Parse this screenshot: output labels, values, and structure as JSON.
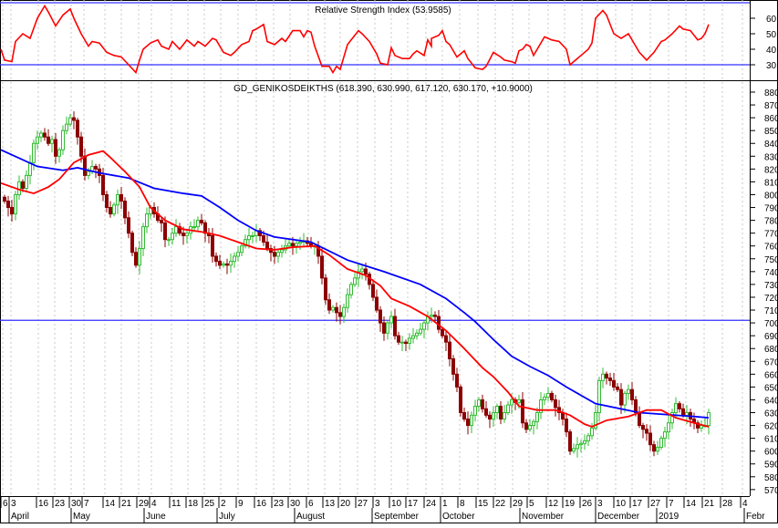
{
  "chart_data": [
    {
      "type": "line",
      "title": "Relative Strength Index (53.9585)",
      "yticks": [
        60,
        50,
        40,
        30
      ],
      "ylim": [
        25,
        72
      ],
      "levels": [
        70,
        30
      ],
      "colors": {
        "line": "#ff0000",
        "levels": "#3333ff"
      },
      "series": [
        {
          "name": "RSI",
          "points": [
            [
              -1,
              40
            ],
            [
              0,
              33
            ],
            [
              2,
              32
            ],
            [
              3,
              45
            ],
            [
              5,
              50
            ],
            [
              7,
              47
            ],
            [
              9,
              60
            ],
            [
              11,
              68
            ],
            [
              12,
              64
            ],
            [
              14,
              55
            ],
            [
              16,
              62
            ],
            [
              18,
              66
            ],
            [
              19,
              60
            ],
            [
              21,
              50
            ],
            [
              23,
              42
            ],
            [
              24,
              45
            ],
            [
              26,
              44
            ],
            [
              28,
              38
            ],
            [
              30,
              36
            ],
            [
              32,
              35
            ],
            [
              34,
              30
            ],
            [
              36,
              25
            ],
            [
              37,
              33
            ],
            [
              38,
              40
            ],
            [
              40,
              44
            ],
            [
              42,
              46
            ],
            [
              43,
              42
            ],
            [
              45,
              40
            ],
            [
              46,
              45
            ],
            [
              48,
              40
            ],
            [
              50,
              46
            ],
            [
              52,
              42
            ],
            [
              53,
              45
            ],
            [
              55,
              42
            ],
            [
              57,
              47
            ],
            [
              58,
              46
            ],
            [
              60,
              38
            ],
            [
              62,
              36
            ],
            [
              63,
              38
            ],
            [
              65,
              43
            ],
            [
              67,
              45
            ],
            [
              68,
              52
            ],
            [
              69,
              53
            ],
            [
              71,
              56
            ],
            [
              72,
              45
            ],
            [
              74,
              43
            ],
            [
              76,
              47
            ],
            [
              77,
              45
            ],
            [
              79,
              52
            ],
            [
              81,
              52
            ],
            [
              82,
              48
            ],
            [
              83,
              52
            ],
            [
              84,
              51
            ],
            [
              85,
              42
            ],
            [
              87,
              29
            ],
            [
              89,
              29
            ],
            [
              90,
              25
            ],
            [
              91,
              29
            ],
            [
              92,
              27
            ],
            [
              94,
              43
            ],
            [
              95,
              46
            ],
            [
              96,
              49
            ],
            [
              97,
              52
            ],
            [
              98,
              50
            ],
            [
              100,
              45
            ],
            [
              102,
              37
            ],
            [
              103,
              31
            ],
            [
              105,
              30
            ],
            [
              106,
              41
            ],
            [
              107,
              36
            ],
            [
              109,
              34
            ],
            [
              111,
              34
            ],
            [
              112,
              37
            ],
            [
              113,
              39
            ],
            [
              115,
              36
            ],
            [
              116,
              46
            ],
            [
              117,
              42
            ],
            [
              117,
              47
            ],
            [
              119,
              49
            ],
            [
              120,
              52
            ],
            [
              121,
              45
            ],
            [
              122,
              43
            ],
            [
              124,
              35
            ],
            [
              126,
              39
            ],
            [
              127,
              34
            ],
            [
              129,
              28
            ],
            [
              131,
              27
            ],
            [
              132,
              29
            ],
            [
              134,
              38
            ],
            [
              136,
              35
            ],
            [
              137,
              33
            ],
            [
              139,
              32
            ],
            [
              140,
              31
            ],
            [
              141,
              39
            ],
            [
              142,
              40
            ],
            [
              143,
              43
            ],
            [
              144,
              42
            ],
            [
              145,
              36
            ],
            [
              146,
              40
            ],
            [
              148,
              48
            ],
            [
              150,
              46
            ],
            [
              152,
              45
            ],
            [
              154,
              40
            ],
            [
              155,
              30
            ],
            [
              156,
              32
            ],
            [
              158,
              36
            ],
            [
              160,
              40
            ],
            [
              161,
              44
            ],
            [
              162,
              60
            ],
            [
              164,
              65
            ],
            [
              165,
              62
            ],
            [
              167,
              50
            ],
            [
              169,
              47
            ],
            [
              171,
              50
            ],
            [
              173,
              42
            ],
            [
              174,
              38
            ],
            [
              176,
              33
            ],
            [
              178,
              38
            ],
            [
              180,
              45
            ],
            [
              181,
              46
            ],
            [
              183,
              50
            ],
            [
              185,
              55
            ],
            [
              186,
              53
            ],
            [
              188,
              52
            ],
            [
              190,
              46
            ],
            [
              191,
              47
            ],
            [
              192,
              50
            ],
            [
              193,
              56
            ]
          ]
        }
      ]
    },
    {
      "type": "candlestick",
      "title": "GD_GENIKOSDEIKTHS (618.390, 630.990, 617.120, 630.170, +10.9000)",
      "ylim": [
        570,
        880
      ],
      "yticks": [
        880,
        870,
        860,
        850,
        840,
        830,
        820,
        810,
        800,
        790,
        780,
        770,
        760,
        750,
        740,
        730,
        720,
        710,
        700,
        690,
        680,
        670,
        660,
        650,
        640,
        630,
        620,
        610,
        600,
        590,
        580,
        570
      ],
      "hline": 702,
      "colors": {
        "up": "#33bb33",
        "down": "#8b0000",
        "ma_fast": "#ff0000",
        "ma_slow": "#0000ff",
        "hline": "#3333ff"
      },
      "closes": [
        795,
        790,
        785,
        800,
        810,
        805,
        815,
        825,
        840,
        845,
        848,
        845,
        840,
        843,
        830,
        835,
        850,
        855,
        860,
        858,
        845,
        830,
        815,
        818,
        822,
        820,
        815,
        800,
        790,
        785,
        792,
        800,
        795,
        782,
        770,
        755,
        745,
        758,
        775,
        785,
        790,
        785,
        780,
        778,
        765,
        765,
        770,
        775,
        770,
        768,
        770,
        775,
        775,
        780,
        778,
        770,
        768,
        752,
        748,
        745,
        746,
        745,
        748,
        752,
        755,
        760,
        765,
        768,
        768,
        772,
        768,
        763,
        758,
        755,
        752,
        755,
        757,
        760,
        762,
        760,
        762,
        763,
        764,
        762,
        760,
        760,
        752,
        735,
        718,
        710,
        712,
        708,
        705,
        712,
        722,
        730,
        735,
        740,
        742,
        738,
        730,
        720,
        710,
        700,
        692,
        700,
        705,
        690,
        685,
        685,
        684,
        688,
        690,
        692,
        695,
        700,
        705,
        706,
        705,
        695,
        690,
        685,
        672,
        660,
        650,
        630,
        625,
        620,
        628,
        635,
        640,
        633,
        628,
        625,
        630,
        635,
        625,
        630,
        636,
        640,
        638,
        640,
        622,
        617,
        620,
        623,
        630,
        640,
        642,
        645,
        640,
        634,
        630,
        625,
        615,
        600,
        602,
        605,
        606,
        608,
        612,
        618,
        630,
        655,
        660,
        657,
        655,
        650,
        648,
        636,
        645,
        648,
        640,
        630,
        620,
        617,
        614,
        605,
        600,
        603,
        610,
        615,
        622,
        630,
        637,
        633,
        628,
        630,
        625,
        622,
        618,
        620,
        620,
        630
      ],
      "ma_fast": [
        [
          -1,
          809
        ],
        [
          4,
          804
        ],
        [
          8,
          801
        ],
        [
          12,
          806
        ],
        [
          15,
          812
        ],
        [
          19,
          825
        ],
        [
          23,
          831
        ],
        [
          27,
          834
        ],
        [
          29,
          829
        ],
        [
          33,
          818
        ],
        [
          37,
          806
        ],
        [
          40,
          790
        ],
        [
          44,
          780
        ],
        [
          49,
          773
        ],
        [
          54,
          771
        ],
        [
          59,
          768
        ],
        [
          64,
          763
        ],
        [
          69,
          758
        ],
        [
          74,
          757
        ],
        [
          79,
          759
        ],
        [
          85,
          760
        ],
        [
          89,
          753
        ],
        [
          94,
          742
        ],
        [
          99,
          737
        ],
        [
          103,
          729
        ],
        [
          106,
          719
        ],
        [
          111,
          713
        ],
        [
          116,
          705
        ],
        [
          121,
          694
        ],
        [
          126,
          680
        ],
        [
          131,
          665
        ],
        [
          134,
          658
        ],
        [
          138,
          646
        ],
        [
          141,
          635
        ],
        [
          146,
          632
        ],
        [
          151,
          632
        ],
        [
          155,
          628
        ],
        [
          159,
          621
        ],
        [
          161,
          619
        ],
        [
          165,
          624
        ],
        [
          171,
          627
        ],
        [
          176,
          632
        ],
        [
          180,
          632
        ],
        [
          184,
          626
        ],
        [
          189,
          622
        ],
        [
          193,
          619
        ]
      ],
      "ma_slow": [
        [
          -1,
          835
        ],
        [
          9,
          822
        ],
        [
          16,
          819
        ],
        [
          20,
          821
        ],
        [
          26,
          817
        ],
        [
          34,
          813
        ],
        [
          41,
          805
        ],
        [
          49,
          801
        ],
        [
          54,
          799
        ],
        [
          59,
          790
        ],
        [
          64,
          780
        ],
        [
          69,
          772
        ],
        [
          74,
          767
        ],
        [
          84,
          763
        ],
        [
          94,
          749
        ],
        [
          104,
          740
        ],
        [
          114,
          730
        ],
        [
          121,
          719
        ],
        [
          126,
          708
        ],
        [
          129,
          701
        ],
        [
          134,
          687
        ],
        [
          139,
          674
        ],
        [
          144,
          666
        ],
        [
          149,
          659
        ],
        [
          154,
          650
        ],
        [
          162,
          637
        ],
        [
          174,
          630
        ],
        [
          189,
          627
        ],
        [
          193,
          626
        ]
      ]
    }
  ],
  "x_axis": {
    "day_labels": [
      "6",
      "3",
      "16",
      "23",
      "30",
      "7",
      "14",
      "21",
      "29",
      "4",
      "11",
      "18",
      "25",
      "2",
      "9",
      "16",
      "23",
      "30",
      "6",
      "13",
      "20",
      "27",
      "3",
      "10",
      "17",
      "24",
      "1",
      "8",
      "15",
      "22",
      "29",
      "5",
      "12",
      "19",
      "26",
      "3",
      "10",
      "17",
      "27",
      "7",
      "14",
      "21",
      "28",
      "4"
    ],
    "month_labels": [
      "April",
      "May",
      "June",
      "July",
      "August",
      "September",
      "October",
      "November",
      "December",
      "2019",
      "Febr"
    ]
  }
}
